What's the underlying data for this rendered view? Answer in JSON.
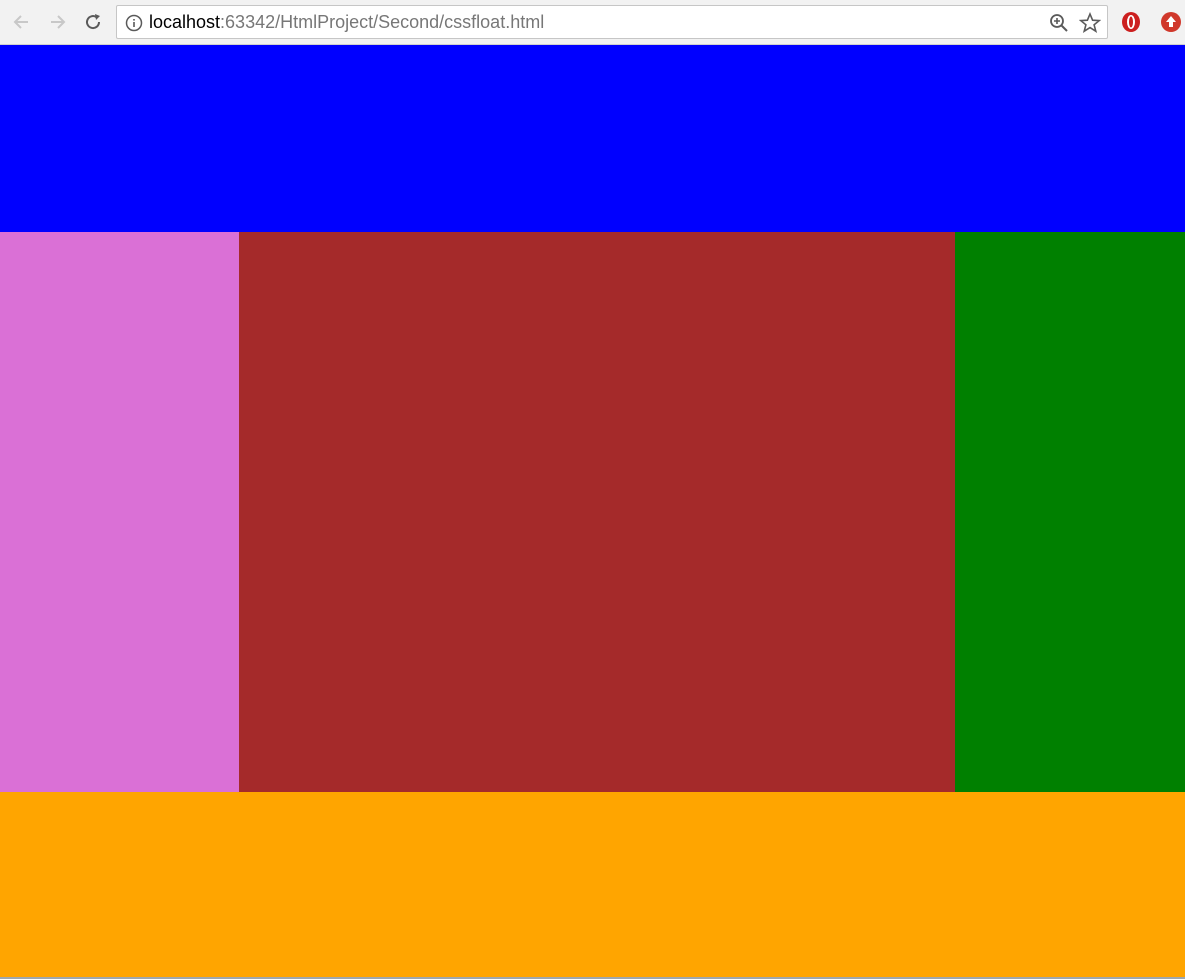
{
  "browser": {
    "url_host": "localhost",
    "url_rest": ":63342/HtmlProject/Second/cssfloat.html"
  },
  "layout_blocks": {
    "header_color": "#0000ff",
    "left_color": "#da70d6",
    "middle_color": "#a52a2a",
    "right_color": "#008000",
    "footer_color": "#ffa500"
  }
}
